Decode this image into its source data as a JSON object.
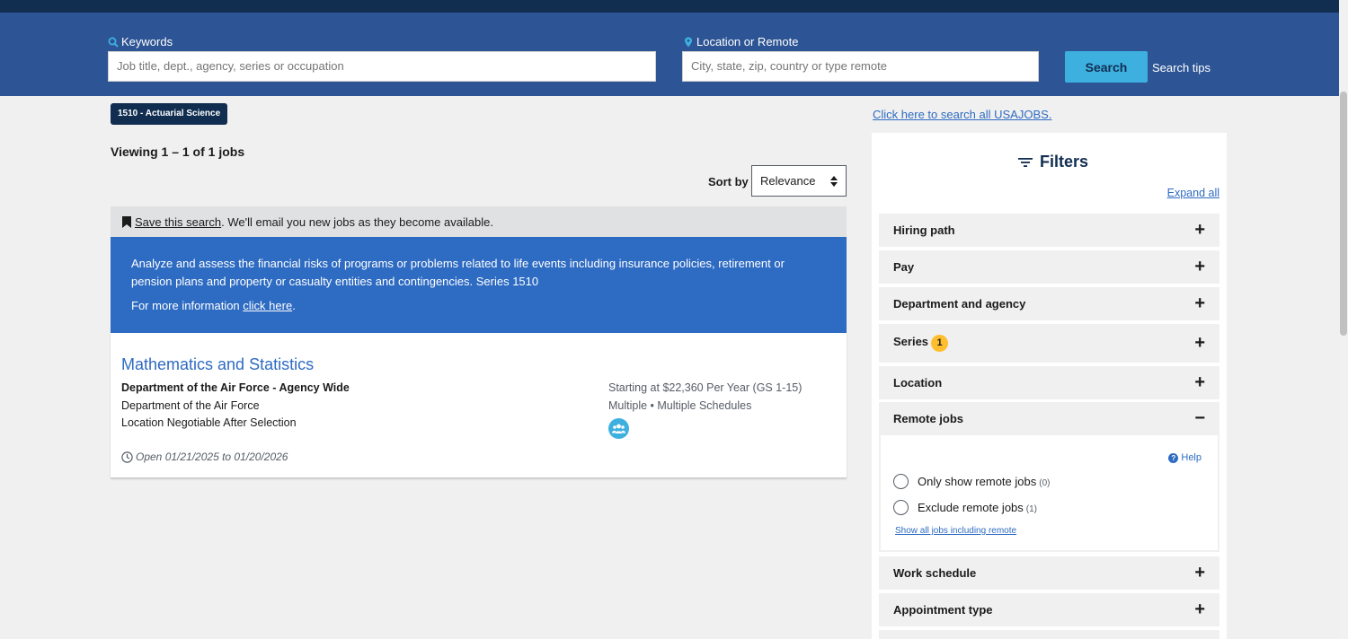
{
  "search": {
    "keywords_label": "Keywords",
    "keywords_placeholder": "Job title, dept., agency, series or occupation",
    "location_label": "Location or Remote",
    "location_placeholder": "City, state, zip, country or type remote",
    "search_button": "Search",
    "tips_link": "Search tips"
  },
  "results": {
    "series_tag": "1510 - Actuarial Science",
    "viewing": "Viewing 1 – 1 of 1 jobs",
    "sort_label": "Sort by",
    "sort_value": "Relevance",
    "save_link": "Save this search",
    "save_text": ". We'll email you new jobs as they become available.",
    "series_description": "Analyze and assess the financial risks of programs or problems related to life events including insurance policies, retirement or pension plans and property or casualty entities and contingencies. Series 1510",
    "more_info_prefix": "For more information ",
    "more_info_link": "click here",
    "more_info_suffix": "."
  },
  "job": {
    "title": "Mathematics and Statistics",
    "agency": "Department of the Air Force - Agency Wide",
    "department": "Department of the Air Force",
    "location": "Location Negotiable After Selection",
    "salary": "Starting at $22,360 Per Year (GS 1-15)",
    "schedule": "Multiple • Multiple Schedules",
    "open_dates": "Open 01/21/2025 to 01/20/2026"
  },
  "sidebar": {
    "all_jobs_link": "Click here to search all USAJOBS.",
    "filters_title": "Filters",
    "expand_all": "Expand all",
    "accordions": [
      {
        "label": "Hiring path",
        "sign": "+"
      },
      {
        "label": "Pay",
        "sign": "+"
      },
      {
        "label": "Department and agency",
        "sign": "+"
      },
      {
        "label": "Series",
        "sign": "+",
        "badge": "1"
      },
      {
        "label": "Location",
        "sign": "+"
      },
      {
        "label": "Remote jobs",
        "sign": "−"
      },
      {
        "label": "Work schedule",
        "sign": "+"
      },
      {
        "label": "Appointment type",
        "sign": "+"
      }
    ],
    "remote": {
      "help": "Help",
      "help_glyph": "?",
      "option1": "Only show remote jobs",
      "option1_count": "(0)",
      "option2": "Exclude remote jobs",
      "option2_count": "(1)",
      "show_all": "Show all jobs including remote"
    }
  },
  "colors": {
    "header_dark": "#112e51",
    "search_band": "#2d5494",
    "accent_blue": "#2e6bc2",
    "search_button": "#3db0e0",
    "badge_gold": "#ffbe2e"
  }
}
